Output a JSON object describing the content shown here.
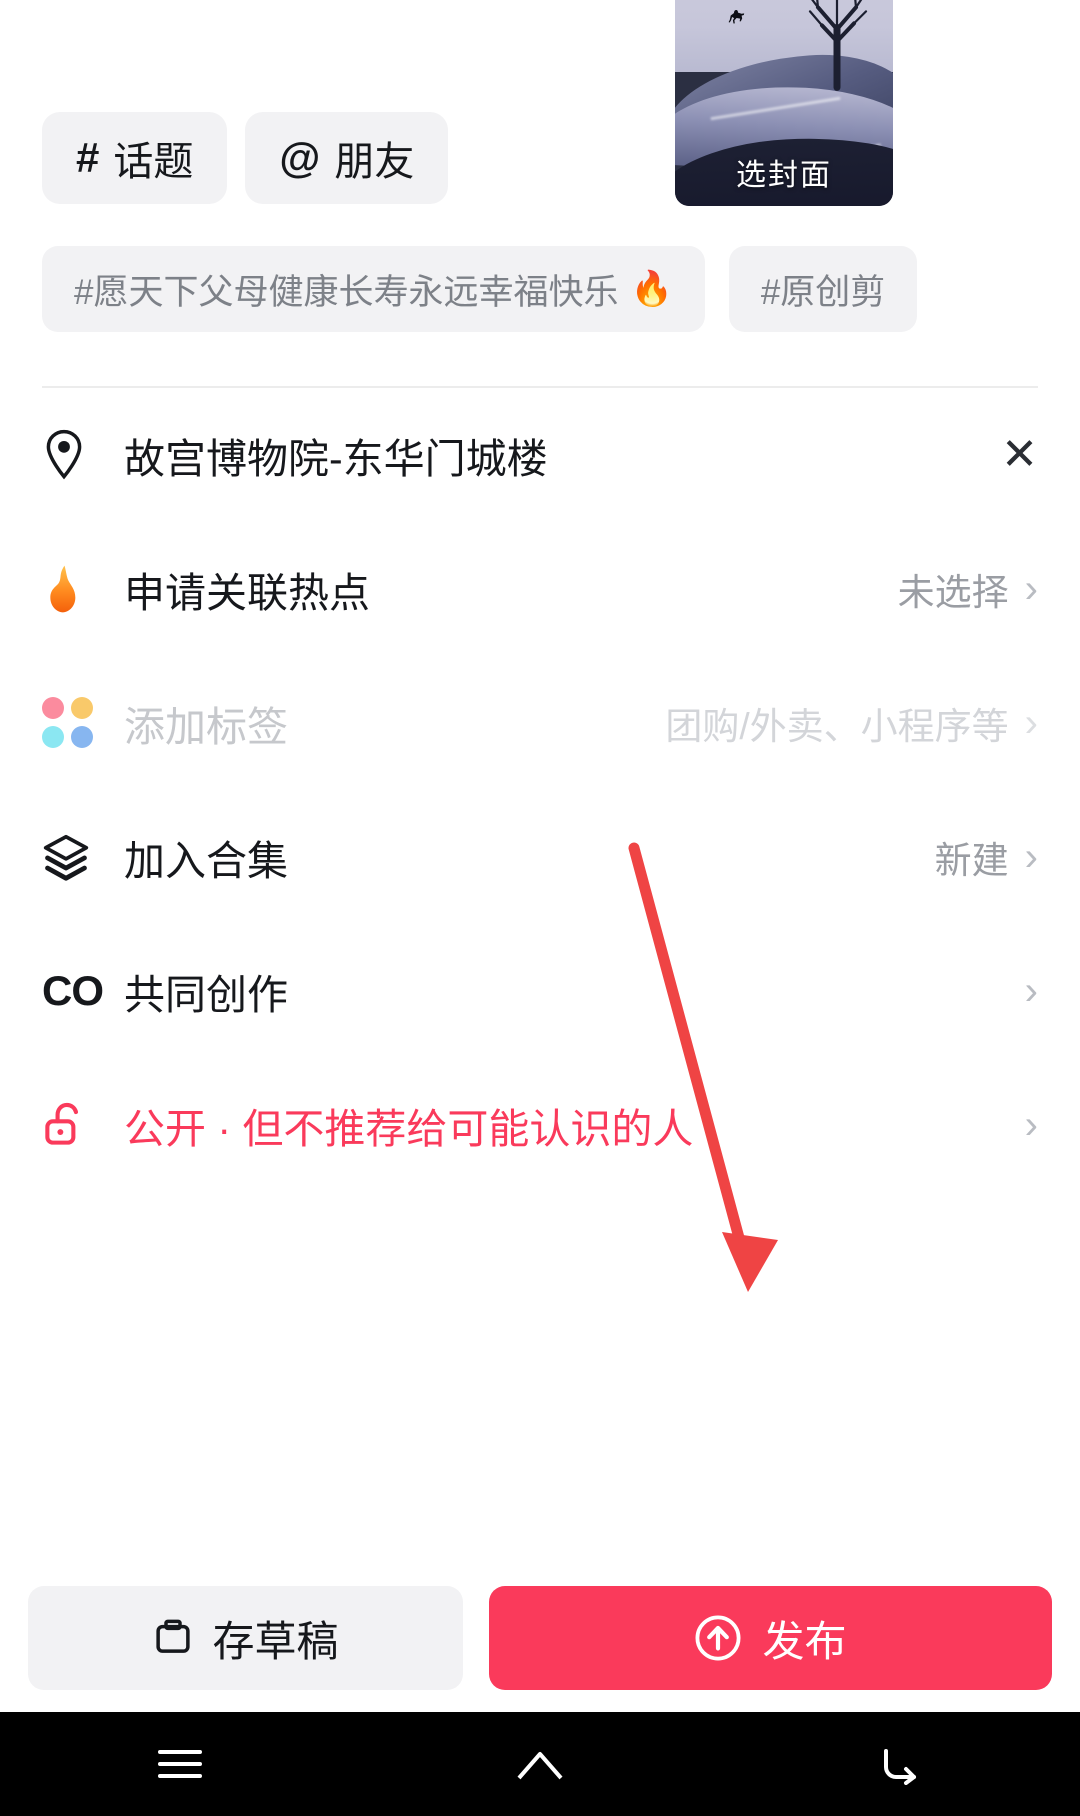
{
  "cover": {
    "label": "选封面",
    "icon": "cover-thumbnail"
  },
  "chips": [
    {
      "symbol": "#",
      "label": "话题",
      "name": "topic"
    },
    {
      "symbol": "@",
      "label": "朋友",
      "name": "friend"
    }
  ],
  "tag_suggestions": [
    {
      "text": "#愿天下父母健康长寿永远幸福快乐",
      "flame": "🔥"
    },
    {
      "text": "#原创剪",
      "flame": ""
    }
  ],
  "rows": [
    {
      "icon": "location-pin-icon",
      "label": "故宫博物院-东华门城楼",
      "value": "",
      "trailing": "close-icon",
      "style": "normal"
    },
    {
      "icon": "flame-icon",
      "label": "申请关联热点",
      "value": "未选择",
      "trailing": "chevron-right-icon",
      "style": "normal"
    },
    {
      "icon": "four-dots-icon",
      "label": "添加标签",
      "value": "团购/外卖、小程序等",
      "trailing": "chevron-right-icon",
      "style": "muted"
    },
    {
      "icon": "layers-icon",
      "label": "加入合集",
      "value": "新建",
      "trailing": "chevron-right-icon",
      "style": "normal"
    },
    {
      "icon": "co-create-icon",
      "label": "共同创作",
      "value": "",
      "trailing": "chevron-right-icon",
      "style": "normal"
    },
    {
      "icon": "unlock-icon",
      "label": "公开 · 但不推荐给可能认识的人",
      "value": "",
      "trailing": "chevron-right-icon",
      "style": "pink"
    }
  ],
  "actions": {
    "draft_label": "存草稿",
    "draft_icon": "save-draft-icon",
    "publish_label": "发布",
    "publish_icon": "arrow-up-circle-icon"
  },
  "navbar": {
    "menu": "menu-icon",
    "home": "home-icon",
    "back": "back-icon"
  },
  "colors": {
    "accent": "#fa3a5b",
    "chip_bg": "#f2f2f4",
    "text": "#16181c",
    "muted": "#9a9da3",
    "faint": "#d3d5d9",
    "annotation_arrow": "#ef4444"
  }
}
